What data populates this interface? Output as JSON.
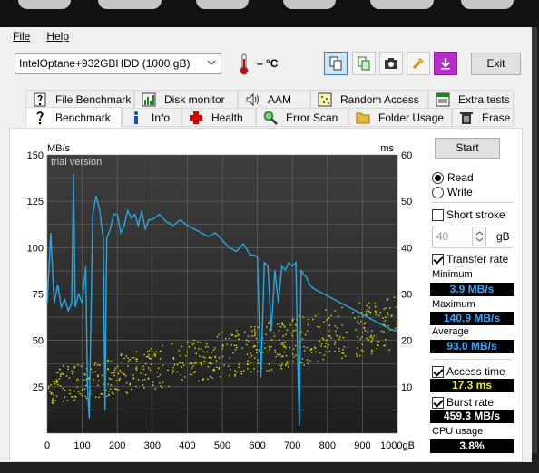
{
  "menu": {
    "file": "File",
    "help": "Help"
  },
  "drive": {
    "selected": "IntelOptane+932GBHDD (1000 gB)"
  },
  "temperature": "– °C",
  "toolbar": {
    "exit_label": "Exit"
  },
  "tabs_row1": [
    {
      "label": "File Benchmark"
    },
    {
      "label": "Disk monitor"
    },
    {
      "label": "AAM"
    },
    {
      "label": "Random Access"
    },
    {
      "label": "Extra tests"
    }
  ],
  "tabs_row2": [
    {
      "label": "Benchmark"
    },
    {
      "label": "Info"
    },
    {
      "label": "Health"
    },
    {
      "label": "Error Scan"
    },
    {
      "label": "Folder Usage"
    },
    {
      "label": "Erase"
    }
  ],
  "controls": {
    "start_label": "Start",
    "read_label": "Read",
    "write_label": "Write",
    "short_stroke_label": "Short stroke",
    "short_stroke_value": "40",
    "short_stroke_unit": "gB",
    "transfer_rate_label": "Transfer rate",
    "access_time_label": "Access time",
    "burst_rate_label": "Burst rate",
    "cpu_usage_label": "CPU usage"
  },
  "stats": {
    "minimum_label": "Minimum",
    "minimum": "3.9 MB/s",
    "maximum_label": "Maximum",
    "maximum": "140.9 MB/s",
    "average_label": "Average",
    "average": "93.0 MB/s",
    "access_time": "17.3 ms",
    "burst_rate": "459.3 MB/s",
    "cpu_usage": "3.8%"
  },
  "chart_data": {
    "type": "line",
    "left_unit": "MB/s",
    "right_unit": "ms",
    "watermark": "trial version",
    "x_ticks": [
      "0",
      "100",
      "200",
      "300",
      "400",
      "500",
      "600",
      "700",
      "800",
      "900",
      "1000gB"
    ],
    "y_left_ticks": [
      "150",
      "125",
      "100",
      "75",
      "50",
      "25"
    ],
    "y_right_ticks": [
      "60",
      "50",
      "40",
      "30",
      "20",
      "10"
    ],
    "xlim": [
      0,
      1000
    ],
    "ylim_left": [
      0,
      150
    ],
    "ylim_right": [
      0,
      60
    ],
    "grid": true,
    "series": [
      {
        "color": "#28a8e0",
        "x": [
          0,
          10,
          20,
          30,
          40,
          50,
          60,
          70,
          75,
          80,
          90,
          100,
          110,
          115,
          120,
          130,
          140,
          150,
          160,
          165,
          170,
          180,
          190,
          200,
          210,
          220,
          230,
          240,
          250,
          260,
          270,
          280,
          290,
          300,
          320,
          340,
          360,
          380,
          400,
          420,
          440,
          460,
          480,
          500,
          520,
          540,
          560,
          580,
          590,
          600,
          610,
          620,
          630,
          640,
          650,
          660,
          670,
          680,
          690,
          700,
          710,
          715,
          720,
          725,
          730,
          740,
          750,
          760,
          780,
          800,
          820,
          840,
          860,
          880,
          900,
          920,
          940,
          960,
          980,
          1000
        ],
        "y": [
          70,
          108,
          70,
          80,
          68,
          72,
          66,
          70,
          140,
          68,
          75,
          70,
          90,
          25,
          8,
          118,
          128,
          120,
          105,
          12,
          105,
          110,
          118,
          118,
          108,
          112,
          120,
          116,
          118,
          112,
          120,
          110,
          115,
          115,
          118,
          114,
          112,
          115,
          112,
          110,
          108,
          106,
          108,
          104,
          100,
          98,
          102,
          96,
          96,
          95,
          30,
          92,
          90,
          55,
          88,
          70,
          90,
          88,
          92,
          90,
          92,
          40,
          4,
          88,
          86,
          84,
          80,
          78,
          76,
          74,
          72,
          70,
          68,
          66,
          64,
          62,
          60,
          58,
          56,
          55
        ]
      }
    ],
    "access_time_scatter": {
      "color": "#e8e800",
      "range_ms_start": [
        6,
        14
      ],
      "range_ms_end": [
        18,
        30
      ]
    }
  }
}
